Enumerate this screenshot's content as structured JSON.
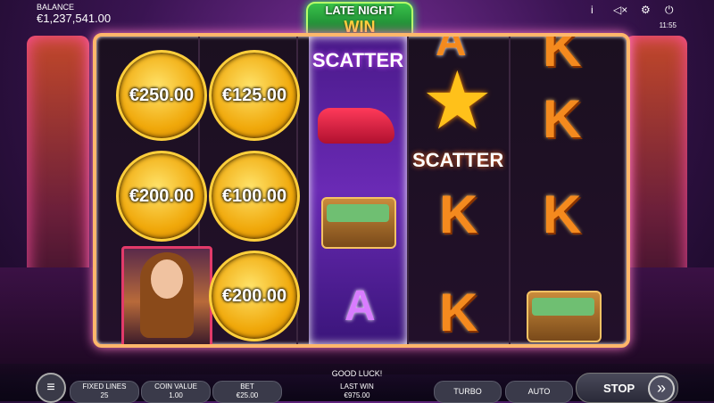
{
  "header": {
    "balance_label": "BALANCE",
    "balance_value": "€1,237,541.00",
    "logo_line1": "LATE NIGHT",
    "logo_line2": "WIN",
    "info_icon": "i",
    "sound_icon": "◁×",
    "settings_icon": "⚙",
    "power_icon": "⏻",
    "time": "11:55"
  },
  "reels": {
    "reel1": {
      "chip1": "€250.00",
      "chip2": "€200.00",
      "symbol3": "woman"
    },
    "reel2": {
      "chip1": "€125.00",
      "chip2": "€100.00",
      "chip3": "€200.00"
    },
    "reel3": {
      "title": "SCATTER",
      "symbol1": "car",
      "symbol2": "money-chest",
      "symbol3": "A"
    },
    "reel4": {
      "top": "A",
      "star_label": "SCATTER",
      "symbol2": "K",
      "symbol3": "K"
    },
    "reel5": {
      "symbol1": "K",
      "symbol2": "K",
      "symbol3": "K",
      "symbol4": "money-chest"
    }
  },
  "bottom": {
    "message": "GOOD LUCK!",
    "menu_icon": "≡",
    "fixed_lines_label": "FIXED LINES",
    "fixed_lines_value": "25",
    "coin_value_label": "COIN VALUE",
    "coin_value_value": "1.00",
    "bet_label": "BET",
    "bet_value": "€25.00",
    "last_win_label": "LAST WIN",
    "last_win_value": "€975.00",
    "turbo_label": "TURBO",
    "auto_label": "AUTO",
    "stop_label": "STOP",
    "stop_arrow": "»"
  }
}
